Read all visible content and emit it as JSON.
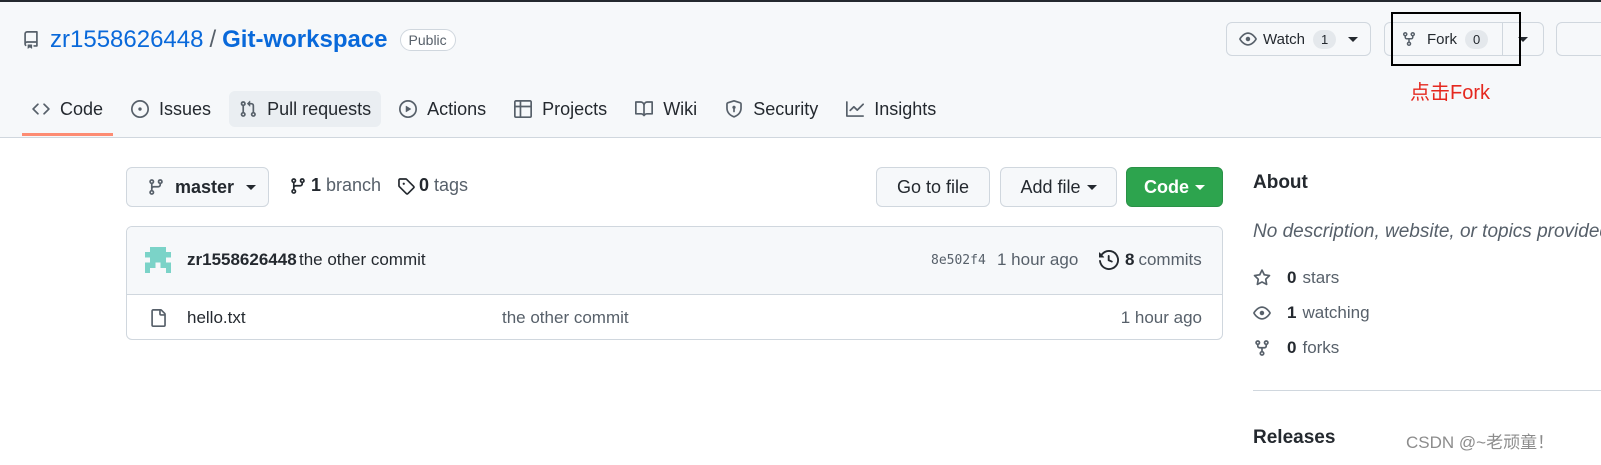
{
  "repo": {
    "owner": "zr1558626448",
    "separator": "/",
    "name": "Git-workspace",
    "visibility": "Public"
  },
  "actions": {
    "watch_label": "Watch",
    "watch_count": "1",
    "fork_label": "Fork",
    "fork_count": "0"
  },
  "annotation": {
    "text": "点击Fork",
    "color": "#e5281f"
  },
  "tabs": [
    {
      "label": "Code",
      "icon": "code-icon",
      "active": true
    },
    {
      "label": "Issues",
      "icon": "issue-icon"
    },
    {
      "label": "Pull requests",
      "icon": "pull-request-icon"
    },
    {
      "label": "Actions",
      "icon": "play-icon"
    },
    {
      "label": "Projects",
      "icon": "table-icon"
    },
    {
      "label": "Wiki",
      "icon": "book-icon"
    },
    {
      "label": "Security",
      "icon": "shield-icon"
    },
    {
      "label": "Insights",
      "icon": "graph-icon"
    }
  ],
  "toolbar": {
    "branch": "master",
    "branch_count": "1",
    "branch_label": "branch",
    "tag_count": "0",
    "tag_label": "tags",
    "goto_file": "Go to file",
    "add_file": "Add file",
    "code": "Code"
  },
  "commit": {
    "author": "zr1558626448",
    "message": "the other commit",
    "sha": "8e502f4",
    "time": "1 hour ago",
    "commit_count": "8",
    "commit_label": "commits"
  },
  "files": [
    {
      "name": "hello.txt",
      "message": "the other commit",
      "time": "1 hour ago"
    }
  ],
  "about": {
    "title": "About",
    "description": "No description, website, or topics provided.",
    "stars_count": "0",
    "stars_label": "stars",
    "watching_count": "1",
    "watching_label": "watching",
    "forks_count": "0",
    "forks_label": "forks"
  },
  "releases_title": "Releases",
  "watermark": "CSDN @~老顽童！",
  "colors": {
    "primary_button": "#2da44e",
    "link": "#0969da",
    "active_tab_underline": "#fd8c73"
  }
}
